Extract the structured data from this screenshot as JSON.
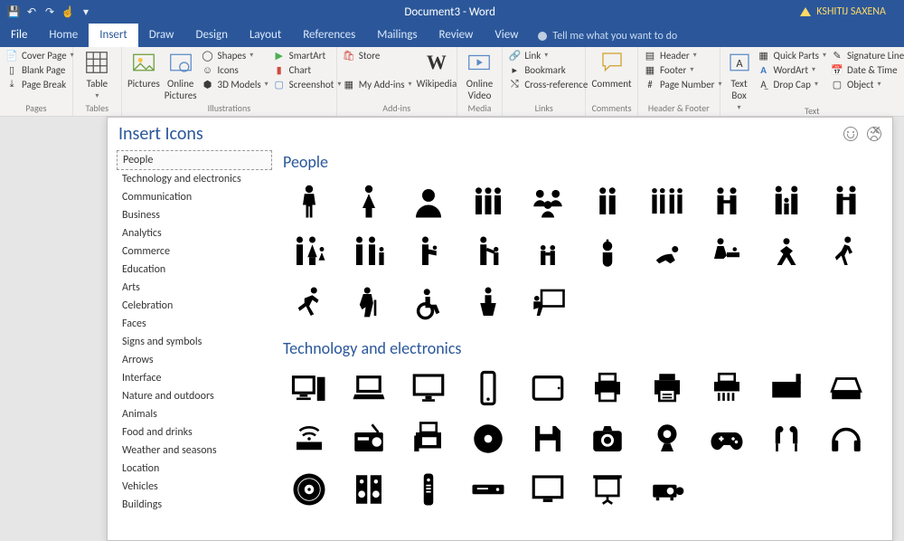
{
  "titlebar": {
    "doc_title": "Document3 - Word",
    "user": "KSHITIJ SAXENA"
  },
  "qat": {
    "save": "💾",
    "undo": "↶",
    "redo": "↷",
    "touch": "☝",
    "more": "▾"
  },
  "tabs": [
    "File",
    "Home",
    "Insert",
    "Draw",
    "Design",
    "Layout",
    "References",
    "Mailings",
    "Review",
    "View"
  ],
  "active_tab": "Insert",
  "tellme": "Tell me what you want to do",
  "ribbon": {
    "pages": {
      "label": "Pages",
      "cover": "Cover Page",
      "blank": "Blank Page",
      "break": "Page Break"
    },
    "tables": {
      "label": "Tables",
      "table": "Table"
    },
    "illustrations": {
      "label": "Illustrations",
      "pictures": "Pictures",
      "online": "Online Pictures",
      "shapes": "Shapes",
      "icons": "Icons",
      "models": "3D Models",
      "smartart": "SmartArt",
      "chart": "Chart",
      "screenshot": "Screenshot"
    },
    "addins": {
      "label": "Add-ins",
      "store": "Store",
      "myaddins": "My Add-ins",
      "wikipedia": "Wikipedia"
    },
    "media": {
      "label": "Media",
      "video": "Online Video"
    },
    "links": {
      "label": "Links",
      "link": "Link",
      "bookmark": "Bookmark",
      "crossref": "Cross-reference"
    },
    "comments": {
      "label": "Comments",
      "comment": "Comment"
    },
    "headerfooter": {
      "label": "Header & Footer",
      "header": "Header",
      "footer": "Footer",
      "pagenum": "Page Number"
    },
    "text": {
      "label": "Text",
      "textbox": "Text Box",
      "quickparts": "Quick Parts",
      "wordart": "WordArt",
      "dropcap": "Drop Cap",
      "sigline": "Signature Line",
      "datetime": "Date & Time",
      "object": "Object"
    }
  },
  "dialog": {
    "title": "Insert Icons",
    "categories": [
      "People",
      "Technology and electronics",
      "Communication",
      "Business",
      "Analytics",
      "Commerce",
      "Education",
      "Arts",
      "Celebration",
      "Faces",
      "Signs and symbols",
      "Arrows",
      "Interface",
      "Nature and outdoors",
      "Animals",
      "Food and drinks",
      "Weather and seasons",
      "Location",
      "Vehicles",
      "Buildings"
    ],
    "selected_category": "People",
    "sections": [
      {
        "title": "People",
        "icons": [
          "man-icon",
          "woman-icon",
          "user-bust-icon",
          "group-three-icon",
          "contacts-tiles-icon",
          "group-two-icon",
          "group-four-icon",
          "group-pair-hold-icon",
          "family-icon",
          "pair-hold-hands-icon",
          "family-child-girl-icon",
          "family-child-boy-icon",
          "parent-carry-icon",
          "adult-child-icon",
          "children-two-icon",
          "baby-icon",
          "baby-crawling-icon",
          "diaper-change-icon",
          "stretch-icon",
          "walking-icon",
          "running-icon",
          "elderly-cane-icon",
          "wheelchair-icon",
          "speaker-podium-icon",
          "teacher-board-icon"
        ]
      },
      {
        "title": "Technology and electronics",
        "icons": [
          "desktop-tower-icon",
          "laptop-icon",
          "monitor-icon",
          "smartphone-icon",
          "tablet-icon",
          "printer-icon",
          "printer-alt-icon",
          "shredder-icon",
          "scanner-flatbed-icon",
          "scanner-lid-icon",
          "router-icon",
          "radio-icon",
          "fax-icon",
          "disc-icon",
          "floppy-icon",
          "camera-icon",
          "webcam-icon",
          "game-controller-icon",
          "earbuds-icon",
          "headphones-icon",
          "vinyl-icon",
          "speakers-icon",
          "remote-icon",
          "dvd-player-icon",
          "tv-icon",
          "projector-screen-icon",
          "projector-icon"
        ]
      }
    ]
  }
}
